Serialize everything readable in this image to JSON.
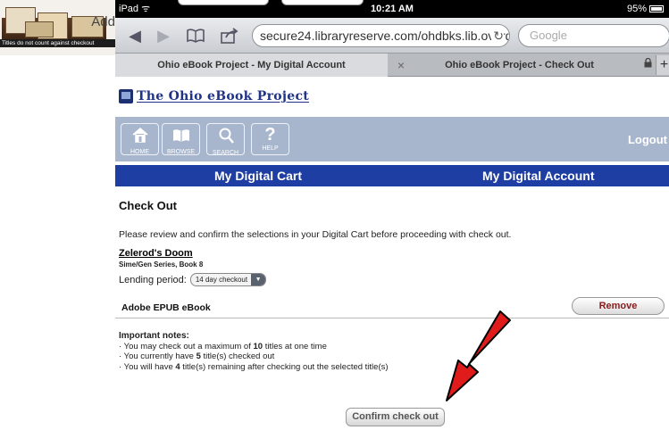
{
  "thumbnail": {
    "add_text": "Add",
    "caption": "Titles do not count against checkout"
  },
  "status_bar": {
    "carrier": "iPad ᯤ",
    "time": "10:21 AM",
    "battery": "95%"
  },
  "toolbar": {
    "url": "secure24.libraryreserve.com/ohdbks.lib.overdrive",
    "search_placeholder": "Google",
    "icons": [
      "back-icon",
      "forward-icon",
      "bookmarks-icon",
      "share-icon",
      "reload-icon"
    ]
  },
  "tabs": {
    "tab1": "Ohio eBook Project - My Digital Account",
    "close_symbol": "×",
    "tab2": "Ohio eBook Project - Check Out",
    "add_symbol": "+"
  },
  "site": {
    "logo_text": "The Ohio eBook Project",
    "nav": [
      {
        "label": "HOME",
        "icon": "home-icon"
      },
      {
        "label": "BROWSE",
        "icon": "browse-icon"
      },
      {
        "label": "SEARCH",
        "icon": "search-icon"
      },
      {
        "label": "HELP",
        "icon": "help-icon"
      }
    ],
    "logout": "Logout",
    "cart_link": "My Digital Cart",
    "account_link": "My Digital Account"
  },
  "checkout": {
    "heading": "Check Out",
    "intro": "Please review and confirm the selections in your Digital Cart before proceeding with check out.",
    "book_title": "Zelerod's Doom",
    "book_series": "Sime/Gen Series, Book 8",
    "lending_label": "Lending period:",
    "lending_value": "14 day checkout",
    "format": "Adobe EPUB eBook",
    "remove_label": "Remove",
    "notes_heading": "Important notes:",
    "note1_pre": "· You may check out a maximum of ",
    "note1_num": "10",
    "note1_post": " titles at one time",
    "note2_pre": "· You currently have ",
    "note2_num": "5",
    "note2_post": " title(s) checked out",
    "note3_pre": "· You will have ",
    "note3_num": "4",
    "note3_post": " title(s) remaining after checking out the selected title(s)",
    "confirm_label": "Confirm check out"
  },
  "colors": {
    "site_blue": "#1f3ea3",
    "nav_band": "#a7b6cc",
    "arrow_red": "#e01b1b"
  }
}
